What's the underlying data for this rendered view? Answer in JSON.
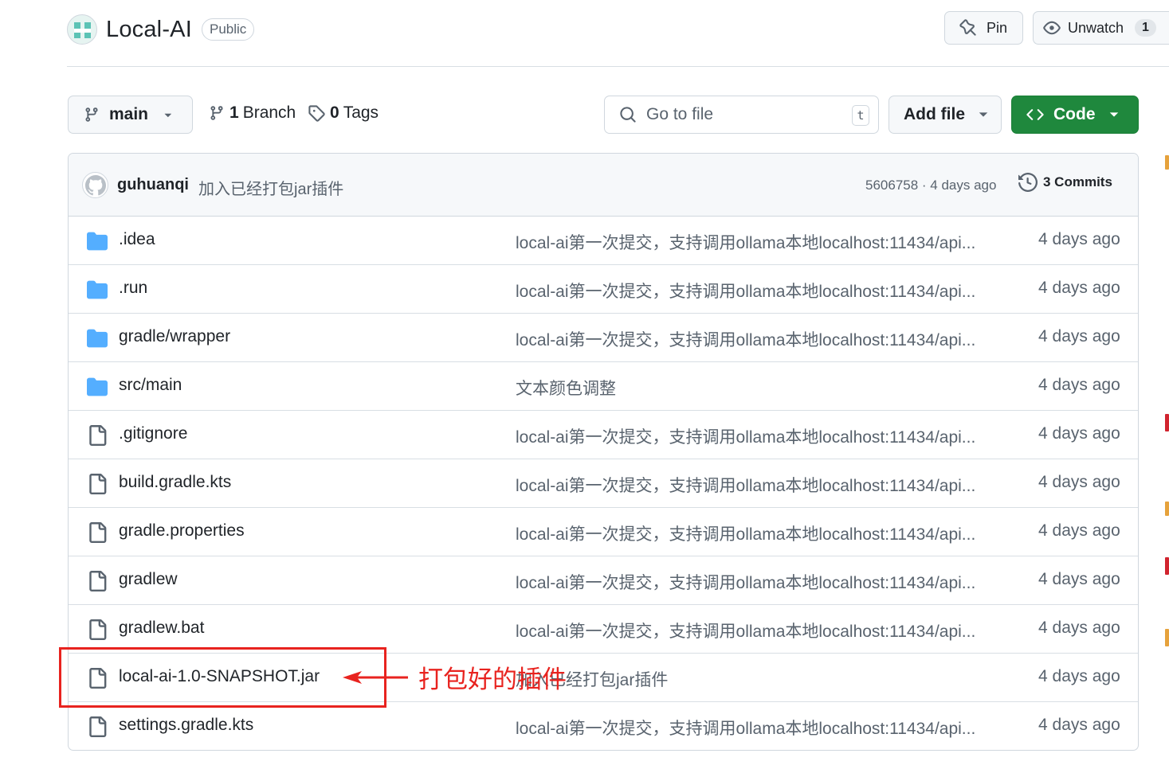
{
  "repo": {
    "name": "Local-AI",
    "visibility": "Public"
  },
  "header": {
    "pin_label": "Pin",
    "unwatch_label": "Unwatch",
    "watch_count": "1"
  },
  "toolbar": {
    "branch": "main",
    "branch_count": "1",
    "branch_label": "Branch",
    "tag_count": "0",
    "tag_label": "Tags",
    "search_placeholder": "Go to file",
    "search_shortcut": "t",
    "add_file_label": "Add file",
    "code_label": "Code",
    "code_color": "#1f883d"
  },
  "latest_commit": {
    "author": "guhuanqi",
    "message": "加入已经打包jar插件",
    "meta": "5606758 · 4 days ago",
    "commits_label": "3 Commits"
  },
  "files": [
    {
      "name": ".idea",
      "type": "folder",
      "message": "local-ai第一次提交，支持调用ollama本地localhost:11434/api...",
      "age": "4 days ago"
    },
    {
      "name": ".run",
      "type": "folder",
      "message": "local-ai第一次提交，支持调用ollama本地localhost:11434/api...",
      "age": "4 days ago"
    },
    {
      "name": "gradle/wrapper",
      "type": "folder",
      "message": "local-ai第一次提交，支持调用ollama本地localhost:11434/api...",
      "age": "4 days ago"
    },
    {
      "name": "src/main",
      "type": "folder",
      "message": "文本颜色调整",
      "age": "4 days ago"
    },
    {
      "name": ".gitignore",
      "type": "file",
      "message": "local-ai第一次提交，支持调用ollama本地localhost:11434/api...",
      "age": "4 days ago"
    },
    {
      "name": "build.gradle.kts",
      "type": "file",
      "message": "local-ai第一次提交，支持调用ollama本地localhost:11434/api...",
      "age": "4 days ago"
    },
    {
      "name": "gradle.properties",
      "type": "file",
      "message": "local-ai第一次提交，支持调用ollama本地localhost:11434/api...",
      "age": "4 days ago"
    },
    {
      "name": "gradlew",
      "type": "file",
      "message": "local-ai第一次提交，支持调用ollama本地localhost:11434/api...",
      "age": "4 days ago"
    },
    {
      "name": "gradlew.bat",
      "type": "file",
      "message": "local-ai第一次提交，支持调用ollama本地localhost:11434/api...",
      "age": "4 days ago"
    },
    {
      "name": "local-ai-1.0-SNAPSHOT.jar",
      "type": "file",
      "message": "加入已经打包jar插件",
      "age": "4 days ago"
    },
    {
      "name": "settings.gradle.kts",
      "type": "file",
      "message": "local-ai第一次提交，支持调用ollama本地localhost:11434/api...",
      "age": "4 days ago"
    }
  ],
  "annotation": {
    "text": "打包好的插件",
    "color": "#e8231f"
  },
  "icons": {
    "folder": "folder-icon",
    "file": "file-icon"
  }
}
